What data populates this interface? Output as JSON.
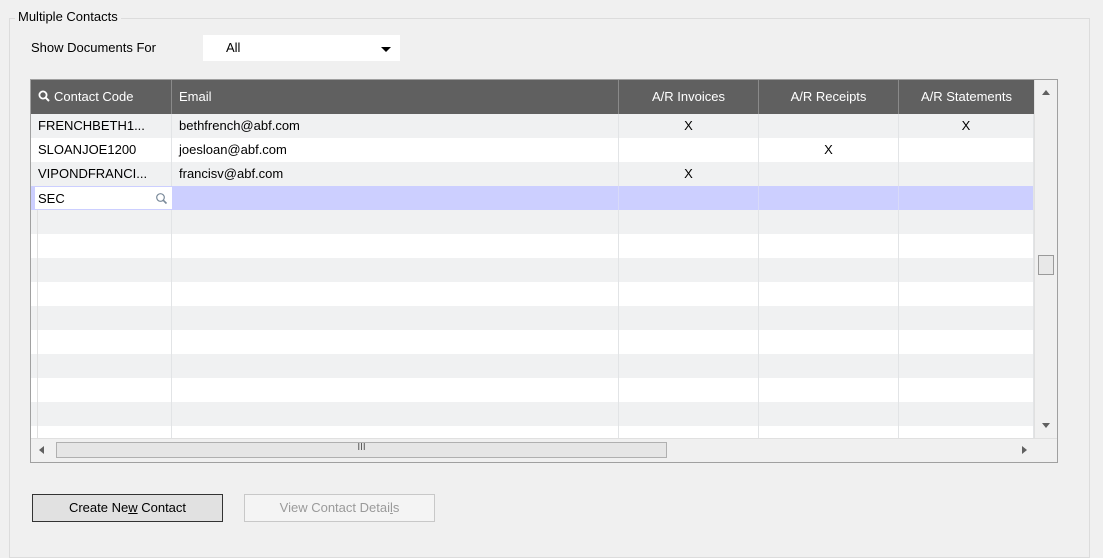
{
  "group": {
    "title": "Multiple Contacts"
  },
  "filter": {
    "label": "Show Documents For",
    "selected": "All"
  },
  "grid": {
    "columns": [
      {
        "label": "Contact Code"
      },
      {
        "label": "Email"
      },
      {
        "label": "A/R Invoices"
      },
      {
        "label": "A/R Receipts"
      },
      {
        "label": "A/R Statements"
      }
    ],
    "rows": [
      {
        "code": "FRENCHBETH1...",
        "email": "bethfrench@abf.com",
        "invoices": "X",
        "receipts": "",
        "statements": "X"
      },
      {
        "code": "SLOANJOE1200",
        "email": "joesloan@abf.com",
        "invoices": "",
        "receipts": "X",
        "statements": ""
      },
      {
        "code": "VIPONDFRANCI...",
        "email": "francisv@abf.com",
        "invoices": "X",
        "receipts": "",
        "statements": ""
      }
    ],
    "edit_row": {
      "code": "SEC"
    },
    "empty_rows": 10,
    "hscroll_grip": "III"
  },
  "buttons": {
    "create": {
      "before": "Create Ne",
      "mnemonic": "w",
      "after": " Contact"
    },
    "view": {
      "before": "View Contact Detai",
      "mnemonic": "l",
      "after": "s"
    }
  },
  "colors": {
    "header_bg": "#606060",
    "selected_row": "#cccfff",
    "alt_row": "#f0f1f2"
  }
}
